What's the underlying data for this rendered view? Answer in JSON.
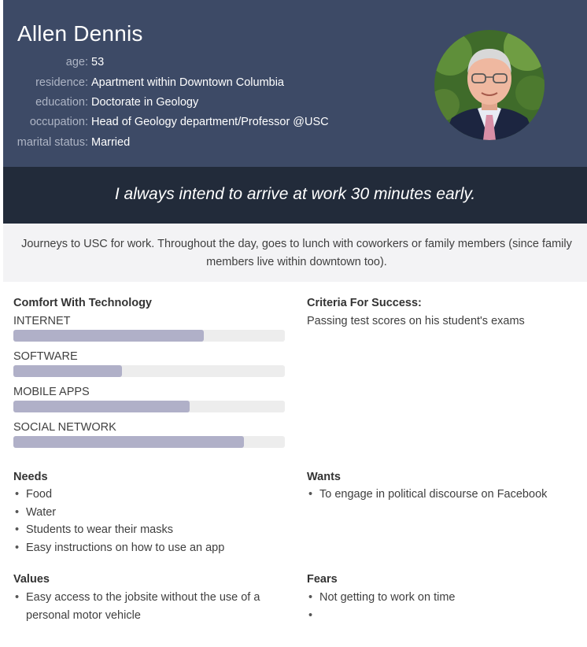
{
  "persona": {
    "name": "Allen Dennis",
    "info": [
      {
        "label": "age:",
        "value": "53"
      },
      {
        "label": "residence:",
        "value": "Apartment within Downtown Columbia"
      },
      {
        "label": "education:",
        "value": "Doctorate in Geology"
      },
      {
        "label": "occupation:",
        "value": "Head of Geology department/Professor @USC"
      },
      {
        "label": "marital status:",
        "value": "Married"
      }
    ],
    "quote": "I always intend to arrive at work 30 minutes early.",
    "journey": "Journeys to USC for work. Throughout the day, goes to lunch with coworkers or family members (since family members live within downtown too)."
  },
  "technology": {
    "title": "Comfort With Technology",
    "items": [
      {
        "label": "INTERNET",
        "level": 0.7
      },
      {
        "label": "SOFTWARE",
        "level": 0.4
      },
      {
        "label": "MOBILE APPS",
        "level": 0.65
      },
      {
        "label": "SOCIAL NETWORK",
        "level": 0.85
      }
    ]
  },
  "success": {
    "title": "Criteria For Success:",
    "text": "Passing test scores on his student's exams"
  },
  "needs": {
    "title": "Needs",
    "items": [
      "Food",
      "Water",
      "Students to wear their masks",
      "Easy instructions on how to use an app"
    ]
  },
  "wants": {
    "title": "Wants",
    "items": [
      "To engage in political discourse on Facebook"
    ]
  },
  "values": {
    "title": "Values",
    "items": [
      "Easy access to the jobsite without the use of a",
      "personal motor vehicle"
    ]
  },
  "fears": {
    "title": "Fears",
    "items": [
      "Not getting to work on time",
      ""
    ]
  },
  "colors": {
    "header_bg": "#3d4a66",
    "quote_bg": "#222b3a",
    "bar_fill": "#b0b0c8",
    "bar_track": "#ededed"
  }
}
